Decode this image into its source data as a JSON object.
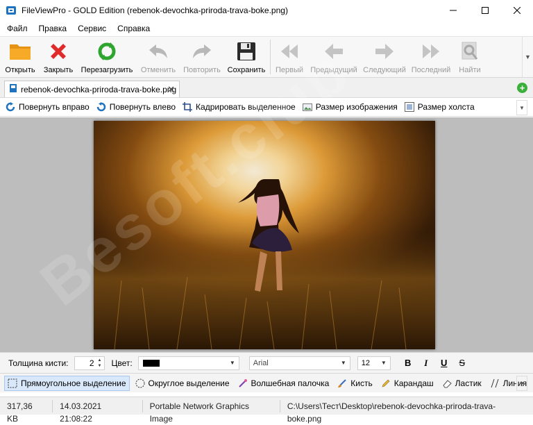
{
  "window": {
    "title": "FileViewPro - GOLD Edition (rebenok-devochka-priroda-trava-boke.png)"
  },
  "menu": [
    "Файл",
    "Правка",
    "Сервис",
    "Справка"
  ],
  "toolbar": {
    "open": "Открыть",
    "close": "Закрыть",
    "reload": "Перезагрузить",
    "undo": "Отменить",
    "redo": "Повторить",
    "save": "Сохранить",
    "first": "Первый",
    "prev": "Предыдущий",
    "next": "Следующий",
    "last": "Последний",
    "find": "Найти"
  },
  "tab": {
    "name": "rebenok-devochka-priroda-trava-boke.png"
  },
  "imagetools": {
    "rotate_right": "Повернуть вправо",
    "rotate_left": "Повернуть влево",
    "crop": "Кадрировать выделенное",
    "image_size": "Размер изображения",
    "canvas_size": "Размер холста"
  },
  "brush": {
    "thickness_label": "Толщина кисти:",
    "thickness_value": "2",
    "color_label": "Цвет:",
    "color_value": "#000000",
    "font": "Arial",
    "font_size": "12",
    "bold": "B",
    "italic": "I",
    "underline": "U",
    "strike": "S"
  },
  "selection": {
    "rect": "Прямоугольное выделение",
    "ellipse": "Округлое выделение",
    "magic": "Волшебная палочка",
    "brush": "Кисть",
    "pencil": "Карандаш",
    "eraser": "Ластик",
    "line": "Линия"
  },
  "status": {
    "size": "317,36 KB",
    "date": "14.03.2021 21:08:22",
    "type": "Portable Network Graphics Image",
    "path": "C:\\Users\\Тест\\Desktop\\rebenok-devochka-priroda-trava-boke.png"
  },
  "watermark": "Besoft.club",
  "colors": {
    "accent": "#1e73be",
    "folder": "#f5a623",
    "close_red": "#e02b2b",
    "reload_green": "#2fa52f"
  }
}
